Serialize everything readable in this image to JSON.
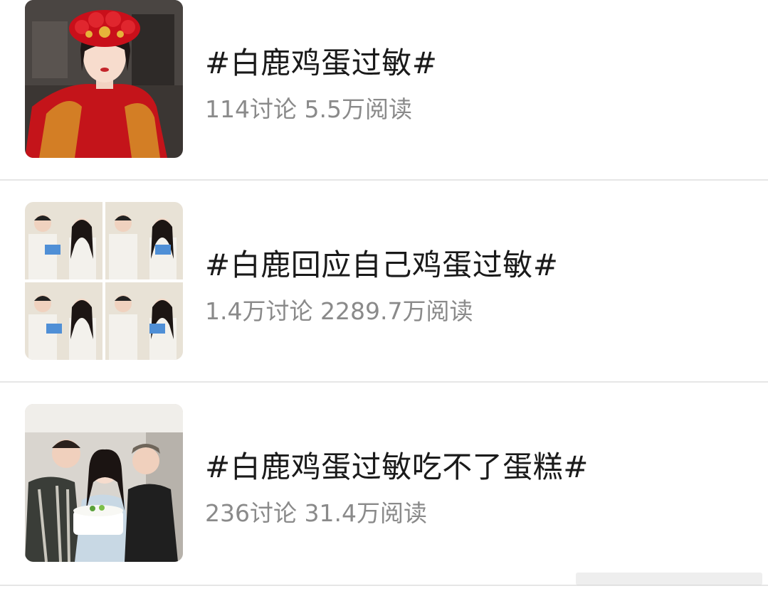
{
  "topics": [
    {
      "title": "#白鹿鸡蛋过敏#",
      "discussions": "114讨论",
      "reads": "5.5万阅读",
      "thumbnail": "woman-red-wedding-costume"
    },
    {
      "title": "#白鹿回应自己鸡蛋过敏#",
      "discussions": "1.4万讨论",
      "reads": "2289.7万阅读",
      "thumbnail": "four-panel-interview-grid"
    },
    {
      "title": "#白鹿鸡蛋过敏吃不了蛋糕#",
      "discussions": "236讨论",
      "reads": "31.4万阅读",
      "thumbnail": "group-photo-with-cake"
    }
  ],
  "colors": {
    "title": "#1a1a1a",
    "meta": "#8a8a8a",
    "divider": "#e6e6e6"
  }
}
